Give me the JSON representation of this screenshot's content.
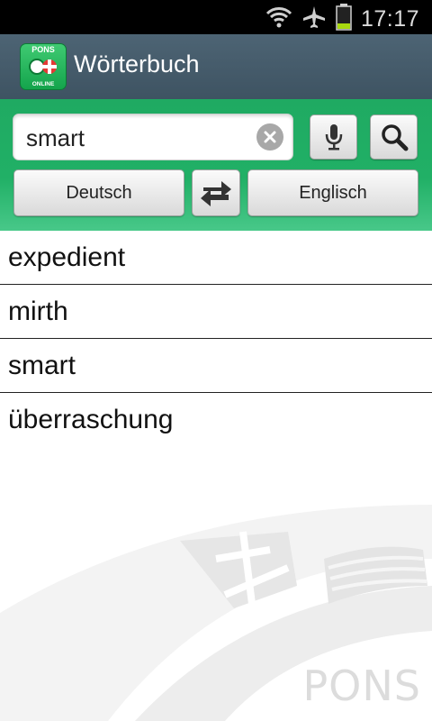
{
  "status_bar": {
    "time": "17:17",
    "icons": [
      "wifi-icon",
      "airplane-mode-icon",
      "battery-icon"
    ],
    "battery_color": "#a8d90f"
  },
  "app_bar": {
    "title": "Wörterbuch",
    "logo": {
      "top_text": "PONS",
      "bottom_text": "ONLINE"
    }
  },
  "search": {
    "value": "smart",
    "clear_icon": "clear-icon",
    "mic_icon": "microphone-icon",
    "search_icon": "search-icon"
  },
  "languages": {
    "from": "Deutsch",
    "to": "Englisch",
    "swap_icon": "swap-arrows-icon"
  },
  "history": {
    "items": [
      "expedient",
      "mirth",
      "smart",
      "überraschung"
    ]
  },
  "watermark": {
    "text": "PONS"
  },
  "colors": {
    "app_bar": "#46606e",
    "panel_green": "#22ae66",
    "text": "#111111"
  }
}
